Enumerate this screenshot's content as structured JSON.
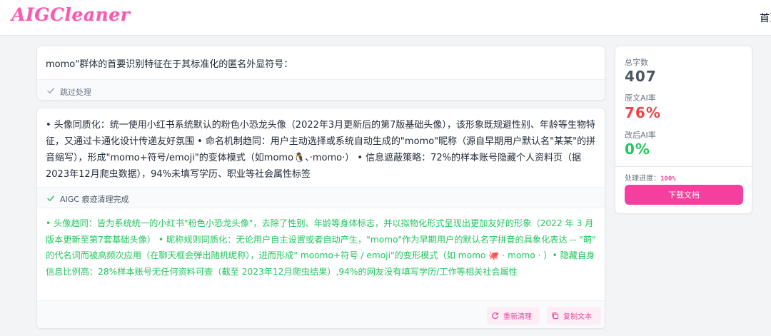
{
  "header": {
    "logo": "AIGCleaner",
    "nav_home": "首页"
  },
  "card1": {
    "text": "momo\"群体的首要识别特征在于其标准化的匿名外显符号：",
    "status_icon": "check-icon",
    "status_label": "跳过处理"
  },
  "card2": {
    "original_text": "• 头像同质化：统一使用小红书系统默认的粉色小恐龙头像（2022年3月更新后的第7版基础头像），该形象既规避性别、年龄等生物特征，又通过卡通化设计传递友好氛围 • 命名机制趋同：用户主动选择或系统自动生成的\"momo\"昵称（源自早期用户默认名\"某某\"的拼音缩写），形成\"momo+符号/emoji\"的变体模式（如momo🐧、·momo·） • 信息遮蔽策略：72%的样本账号隐藏个人资料页（据2023年12月爬虫数据），94%未填写学历、职业等社会属性标签",
    "status_icon": "check-icon",
    "status_label": "AIGC 痕迹清理完成",
    "cleaned_text": "• 头像趋同：皆为系统统一的小红书\"粉色小恐龙头像\"，去除了性别、年龄等身体标志，并以拟物化形式呈现出更加友好的形象（2022 年 3 月版本更新至第7套基础头像） • 昵称规则同质化：无论用户自主设置或者自动产生，\"momo\"作为早期用户的默认名字拼音的具象化表达 -- \"萌\" 的代名词而被高频次应用（在聊天框会弹出随机昵称），进而形成\" moomo+符号 / emoji\"的变形模式（如 momo 🐙 · momo · ）• 隐藏自身信息比例高：28%样本账号无任何资料可查（截至 2023年12月爬虫结果）,94%的网友没有填写学历/工作等相关社会属性",
    "regen_label": "重新清理",
    "regen_icon": "refresh-icon",
    "copy_label": "复制文本",
    "copy_icon": "copy-icon"
  },
  "stats": {
    "total_label": "总字数",
    "total_value": "407",
    "orig_label": "原文AI率",
    "orig_value": "76%",
    "after_label": "改后AI率",
    "after_value": "0%",
    "progress_label": "处理进度：",
    "progress_value": "100%",
    "download_label": "下载文档"
  },
  "colors": {
    "brand_pink": "#f43f9e",
    "red": "#ef4444",
    "green": "#22c55e"
  }
}
